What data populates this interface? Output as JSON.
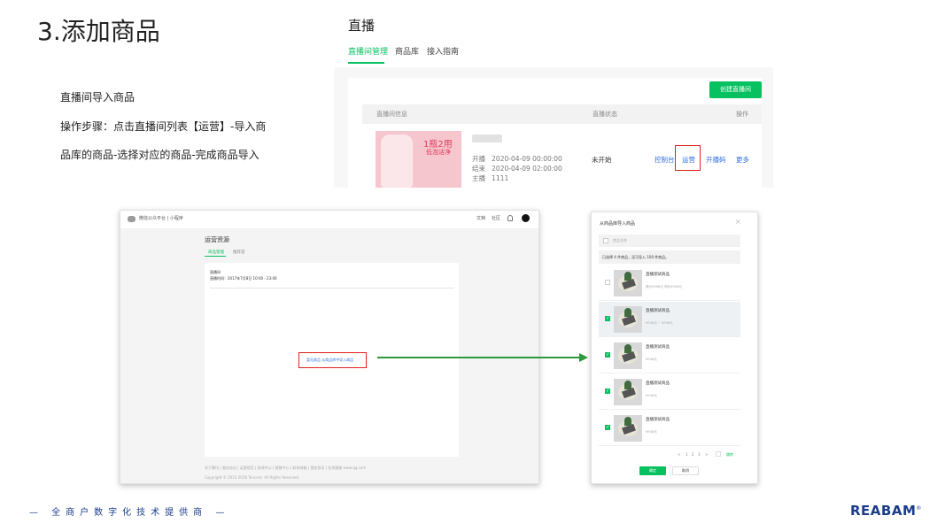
{
  "slide": {
    "title": "3.添加商品",
    "steps": [
      "直播间导入商品",
      "操作步骤：点击直播间列表【运营】-导入商",
      "品库的商品-选择对应的商品-完成商品导入"
    ]
  },
  "live_panel": {
    "title": "直播",
    "tabs": [
      "直播间管理",
      "商品库",
      "接入指南"
    ],
    "create_button": "创建直播间",
    "columns": [
      "直播间信息",
      "直播状态",
      "操作"
    ],
    "cover_big": "1瓶2用",
    "cover_small": "低泡洁净",
    "info": [
      {
        "label": "开播",
        "value": "2020-04-09 00:00:00"
      },
      {
        "label": "结束",
        "value": "2020-04-09 02:00:00"
      },
      {
        "label": "主播",
        "value": "1111"
      }
    ],
    "status": "未开始",
    "actions": [
      "控制台",
      "运营",
      "开播码",
      "更多"
    ]
  },
  "mp_panel": {
    "brand": "微信公众平台 | 小程序",
    "top_right": [
      "文档",
      "社区"
    ],
    "page_title": "运营资源",
    "tabs": [
      "商品管理",
      "推荐官"
    ],
    "card_lines": [
      "直播间",
      "直播时间：2017年7月8日 10:00 - 23:00"
    ],
    "empty_action": "暂无商品  从商品库中导入商品",
    "footer_links": "关于腾讯  |  服务协议  |  运营规范  |  辟谣中心  |  客服中心  |  联系邮箱  |  侵权投诉  |  在线客服  www.qq.com",
    "copyright": "Copyright © 2012-2018 Tencent. All Rights Reserved."
  },
  "modal": {
    "title": "从商品库导入商品",
    "close": "×",
    "search_placeholder": "商品名称",
    "notice": "已选择 4 件商品，还可导入 100 件商品。",
    "products": [
      {
        "name": "直播测试商品",
        "sub": "原价¥998元   现价¥998元",
        "checked": false
      },
      {
        "name": "直播测试商品",
        "sub": "¥948元 ~ ¥998元",
        "checked": true
      },
      {
        "name": "直播测试商品",
        "sub": "¥948元",
        "checked": true
      },
      {
        "name": "直播测试商品",
        "sub": "¥948元",
        "checked": true
      },
      {
        "name": "直播测试商品",
        "sub": "¥948元",
        "checked": true
      }
    ],
    "pager": [
      "<",
      "1",
      "2",
      "3",
      ">"
    ],
    "pager_go": "跳转",
    "ok": "确定",
    "cancel": "取消"
  },
  "footer": {
    "tagline": "— 全商户数字化技术提供商 —",
    "logo": "REABAM",
    "logo_mark": "®"
  },
  "colors": {
    "accent_green": "#07c160",
    "highlight_red": "#e0201c",
    "link_blue": "#2f6fe0",
    "brand_navy": "#1a3c8a"
  }
}
